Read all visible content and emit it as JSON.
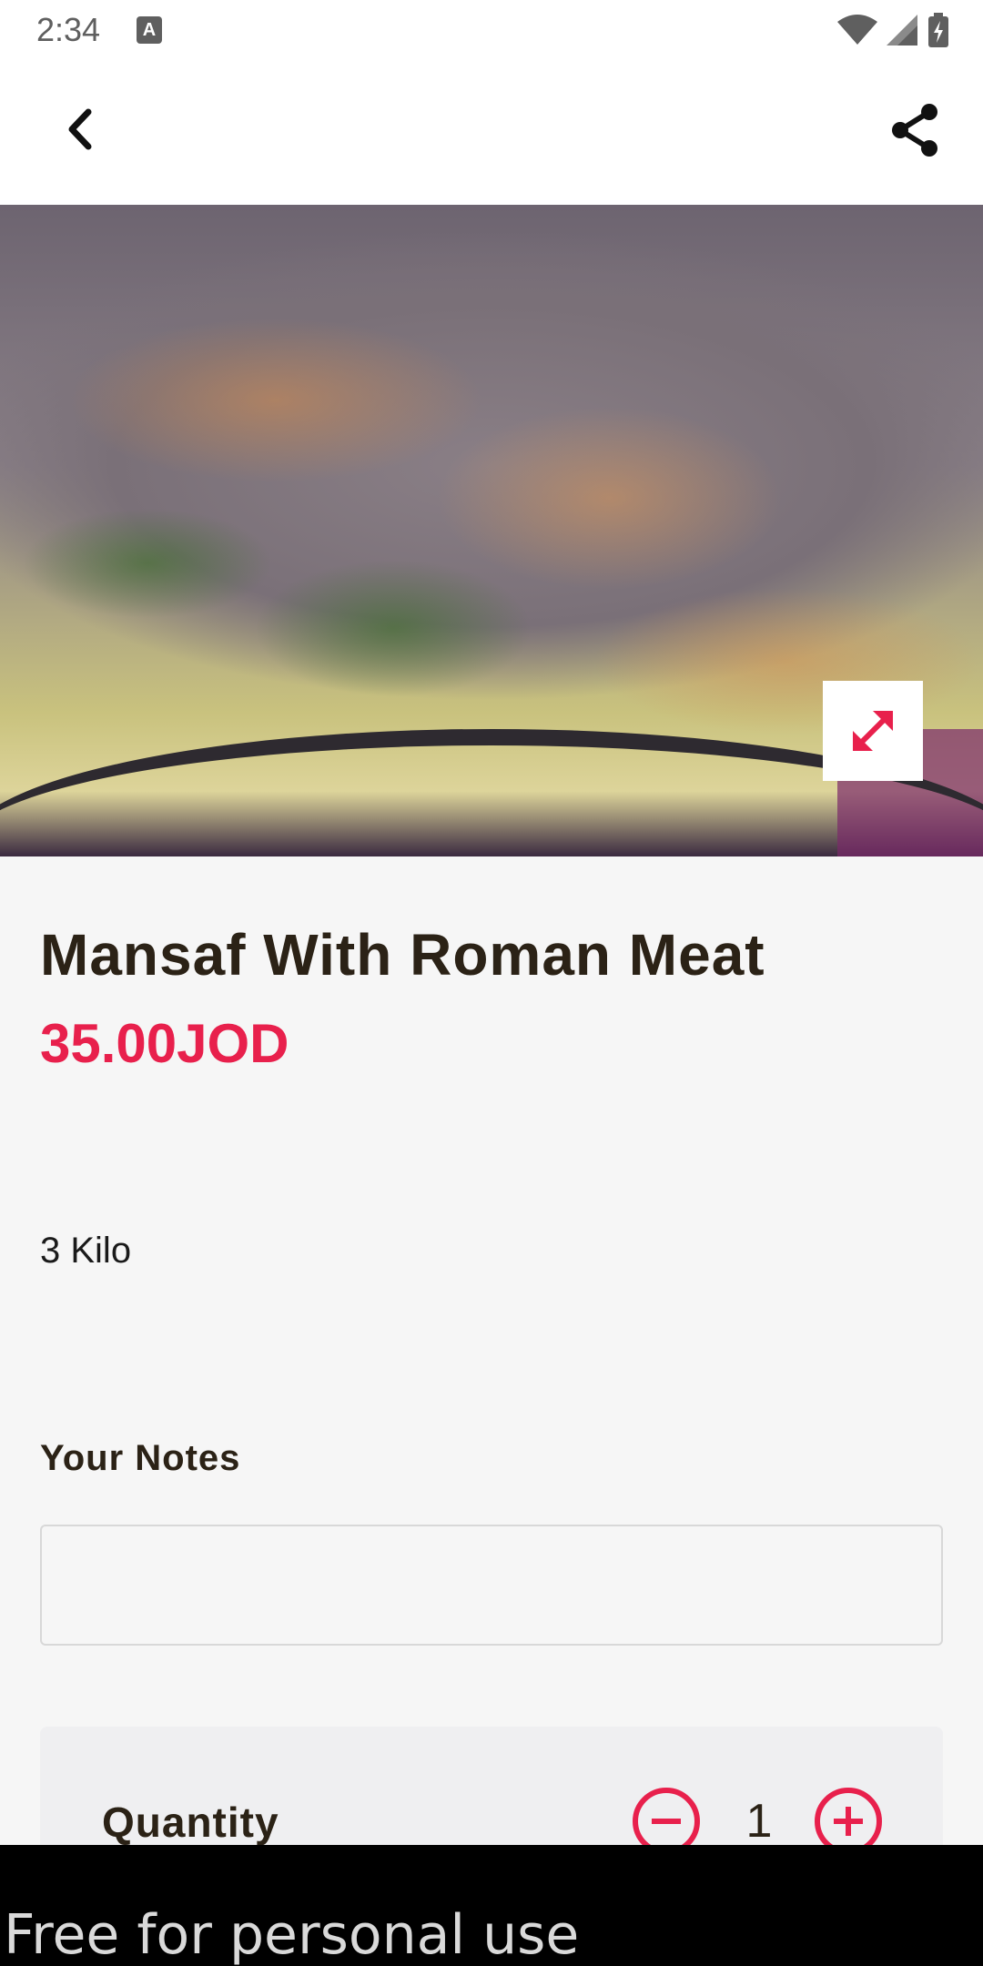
{
  "status_bar": {
    "time": "2:34",
    "notification_letter": "A"
  },
  "app_bar": {
    "back_icon": "chevron-left-icon",
    "share_icon": "share-icon"
  },
  "hero": {
    "image_alt": "Mansaf dish photo",
    "expand_icon": "expand-arrows-icon",
    "accent_color": "#e8204c"
  },
  "product": {
    "title": "Mansaf With Roman Meat",
    "price": "35.00JOD",
    "description": "3 Kilo"
  },
  "notes": {
    "label": "Your Notes",
    "value": "",
    "placeholder": ""
  },
  "quantity": {
    "label": "Quantity",
    "value": "1",
    "minus_icon": "minus-circle-icon",
    "plus_icon": "plus-circle-icon"
  },
  "watermark": {
    "text": "Free for personal use"
  }
}
